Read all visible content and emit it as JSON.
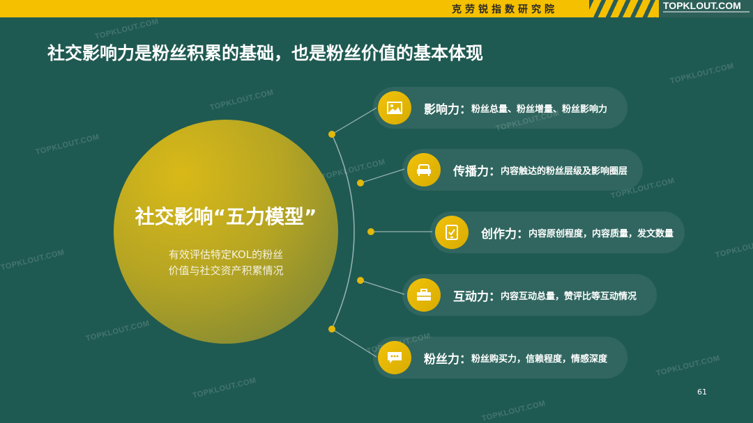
{
  "header": {
    "institute": "克劳锐指数研究院",
    "brand": "TOPKLOUT.COM"
  },
  "page_title": "社交影响力是粉丝积累的基础，也是粉丝价值的基本体现",
  "center": {
    "title": "社交影响“五力模型”",
    "subtitle_line1": "有效评估特定KOL的粉丝",
    "subtitle_line2": "价值与社交资产积累情况"
  },
  "items": [
    {
      "icon": "image-icon",
      "label": "影响力：",
      "desc": "粉丝总量、粉丝增量、粉丝影响力"
    },
    {
      "icon": "sofa-icon",
      "label": "传播力：",
      "desc": "内容触达的粉丝层级及影响圈层"
    },
    {
      "icon": "tablet-check-icon",
      "label": "创作力：",
      "desc": "内容原创程度，内容质量，发文数量"
    },
    {
      "icon": "briefcase-icon",
      "label": "互动力：",
      "desc": "内容互动总量，赞评比等互动情况"
    },
    {
      "icon": "chat-icon",
      "label": "粉丝力：",
      "desc": "粉丝购买力，信赖程度，情感深度"
    }
  ],
  "watermark_text": "TOPKLOUT.COM",
  "page_number": "61",
  "colors": {
    "background": "#1f5a52",
    "accent": "#f5c000",
    "node": "#e3b80a"
  }
}
